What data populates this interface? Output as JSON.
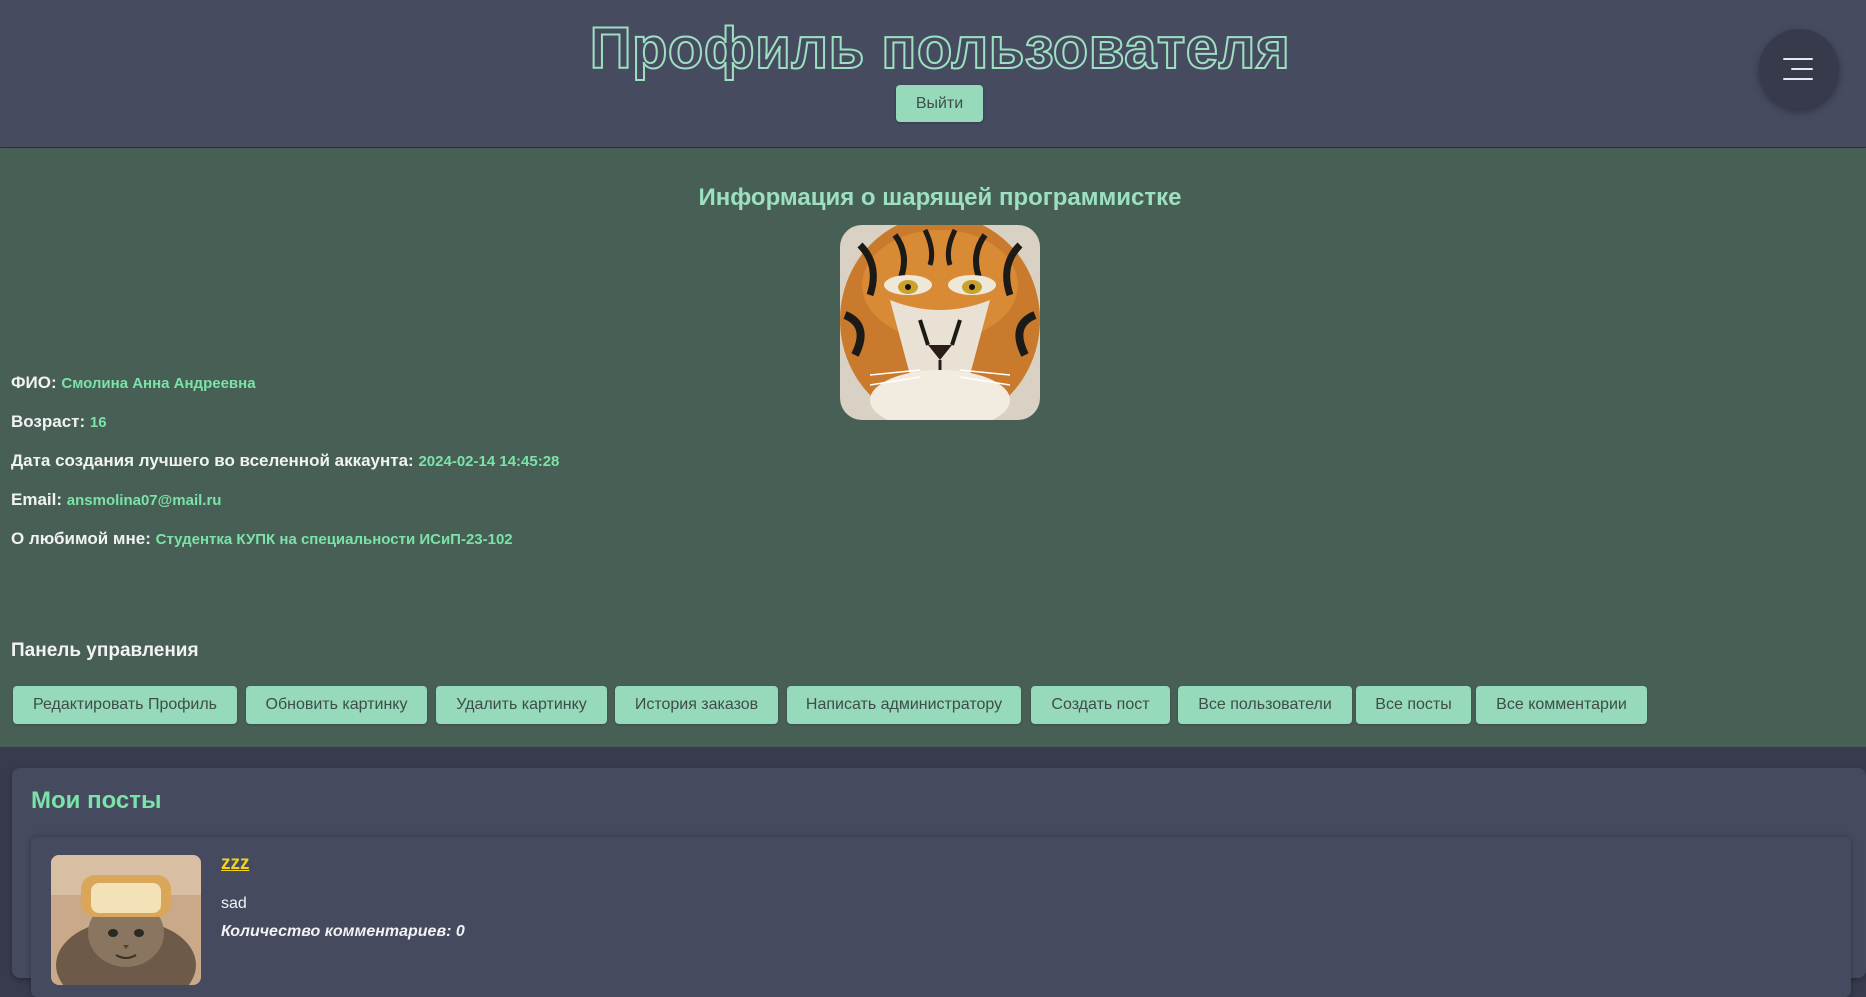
{
  "header": {
    "title": "Профиль пользователя",
    "logout_label": "Выйти",
    "menu_icon": "hamburger-menu-icon"
  },
  "profile": {
    "heading": "Информация о шарящей программистке",
    "avatar_icon": "tiger-avatar-image",
    "fields": [
      {
        "label": "ФИО:",
        "value": "Смолина Анна Андреевна"
      },
      {
        "label": "Возраст:",
        "value": "16"
      },
      {
        "label": "Дата создания лучшего во вселенной аккаунта:",
        "value": "2024-02-14 14:45:28"
      },
      {
        "label": "Email:",
        "value": "ansmolina07@mail.ru"
      },
      {
        "label": "О любимой мне:",
        "value": "Студентка КУПК на специальности ИСиП-23-102"
      }
    ],
    "panel_title": "Панель управления",
    "actions": [
      "Редактировать Профиль",
      "Обновить картинку",
      "Удалить картинку",
      "История заказов",
      "Написать администратору",
      "Создать пост",
      "Все пользователи",
      "Все посты",
      "Все комментарии"
    ]
  },
  "posts": {
    "title": "Мои посты",
    "items": [
      {
        "title": "zzz",
        "text": "sad",
        "comments": "Количество комментариев: 0",
        "image_icon": "cat-bread-image"
      }
    ]
  },
  "colors": {
    "header_bg": "#464b60",
    "profile_bg": "#475f55",
    "accent_mint": "#96d9bb",
    "value_green": "#7be3a8",
    "post_title_yellow": "#f3d21c"
  }
}
